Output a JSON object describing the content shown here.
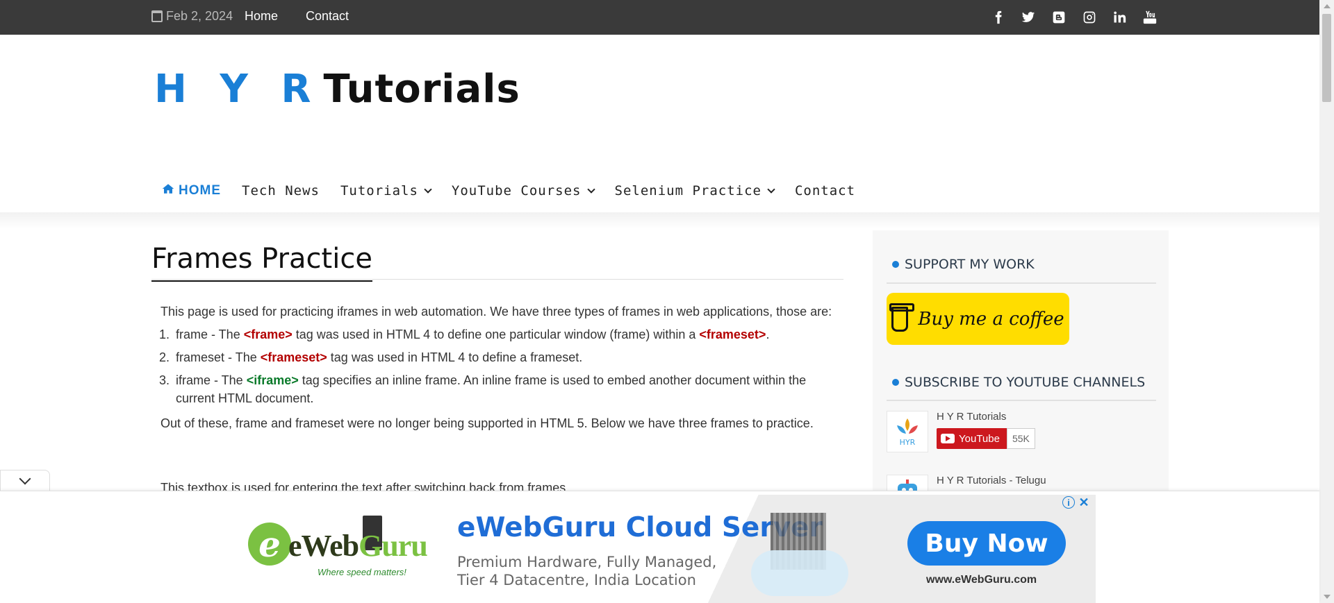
{
  "topbar": {
    "date": "Feb 2, 2024",
    "links": [
      "Home",
      "Contact"
    ],
    "social_icons": [
      "facebook-icon",
      "twitter-icon",
      "blogger-icon",
      "instagram-icon",
      "linkedin-icon",
      "youtube-icon"
    ]
  },
  "header": {
    "logo_part1": "H Y R",
    "logo_part2": "Tutorials"
  },
  "nav": {
    "items": [
      {
        "label": "HOME",
        "active": true
      },
      {
        "label": "Tech News"
      },
      {
        "label": "Tutorials",
        "dropdown": true
      },
      {
        "label": "YouTube Courses",
        "dropdown": true
      },
      {
        "label": "Selenium Practice",
        "dropdown": true
      },
      {
        "label": "Contact"
      }
    ]
  },
  "main": {
    "title": "Frames Practice",
    "intro": "This page is used for practicing iframes in web automation. We have three types of frames in web applications, those are:",
    "list": [
      {
        "pre": "frame - The ",
        "tag": "<frame>",
        "mid": " tag was used in HTML 4 to define one particular window (frame) within a ",
        "tag2": "<frameset>",
        "post": "."
      },
      {
        "pre": "frameset - The ",
        "tag": "<frameset>",
        "mid": " tag was used in HTML 4 to define a frameset.",
        "tag2": "",
        "post": ""
      },
      {
        "pre": "iframe - The ",
        "tag": "<iframe>",
        "mid": " tag specifies an inline frame. An inline frame is used to embed another document within the current HTML document.",
        "tag2": "",
        "post": ""
      }
    ],
    "outro": "Out of these, frame and frameset were no longer being supported in HTML 5. Below we have three frames to practice.",
    "cut_text": "This textbox is used for entering the text after switching back from frames."
  },
  "sidebar": {
    "support_title": "SUPPORT MY WORK",
    "coffee_label": "Buy me a coffee",
    "subscribe_title": "SUBSCRIBE TO YOUTUBE CHANNELS",
    "channels": [
      {
        "name": "H Y R Tutorials",
        "button": "YouTube",
        "count": "55K"
      },
      {
        "name": "H Y R Tutorials - Telugu"
      }
    ]
  },
  "ad": {
    "brand_e": "e",
    "brand_name_1": "eWeb",
    "brand_name_2": "Guru",
    "slogan": "Where speed matters!",
    "headline": "eWebGuru Cloud Server",
    "sub1": "Premium Hardware, Fully Managed,",
    "sub2": "Tier 4 Datacentre, India Location",
    "cta": "Buy Now",
    "url": "www.eWebGuru.com"
  },
  "colors": {
    "topbar_bg": "#3a3a3a",
    "accent": "#1a7fd6",
    "tag_red": "#b30000",
    "tag_green": "#0a7a2a",
    "coffee_yellow": "#ffdd00",
    "youtube_red": "#cc181e"
  }
}
